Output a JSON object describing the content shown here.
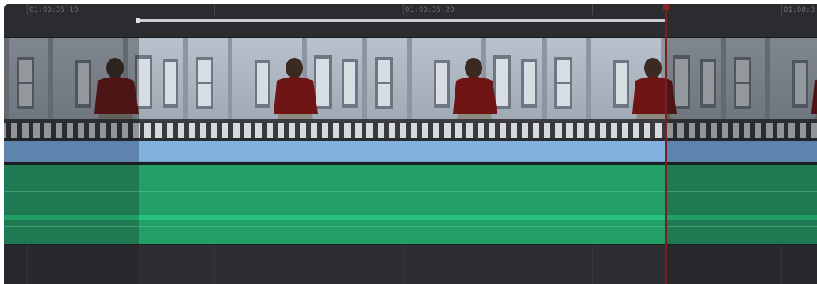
{
  "timeline": {
    "ruler": {
      "timecodes": [
        "01:00:35:10",
        "01:00:35:20",
        "01:00:3"
      ]
    },
    "video_track": {
      "thumbnail_subject": "woman-on-balcony-frames"
    },
    "audio_track": {
      "selected_color": "#22a066",
      "unselected_color": "#1f7a53"
    },
    "colors": {
      "video_label_selected": "#82b3e0",
      "video_label": "#5e84ad",
      "playhead": "#7a2020"
    }
  }
}
